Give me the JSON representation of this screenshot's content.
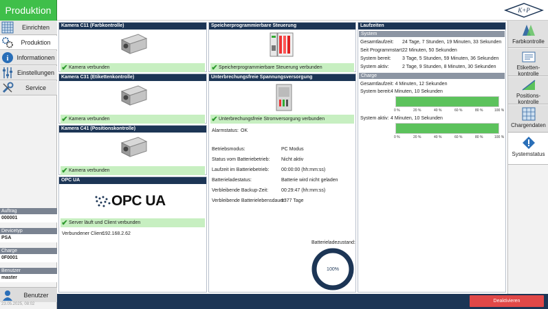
{
  "header": {
    "title": "Produktion"
  },
  "nav": {
    "items": [
      {
        "label": "Einrichten",
        "icon": "grid-tools-icon"
      },
      {
        "label": "Produktion",
        "icon": "gears-icon"
      },
      {
        "label": "Informationen",
        "icon": "info-icon"
      },
      {
        "label": "Einstellungen",
        "icon": "sliders-icon"
      },
      {
        "label": "Service",
        "icon": "wrench-icon"
      }
    ]
  },
  "info": {
    "auftrag_label": "Auftrag",
    "auftrag": "000001",
    "devicetyp_label": "Devicetyp",
    "devicetyp": "PSA",
    "charge_label": "Charge",
    "charge": "0F0001",
    "benutzer_label": "Benutzer",
    "benutzer": "master"
  },
  "user_button": "Benutzer",
  "datetime": "23.05.2025, 08:02",
  "cameras": [
    {
      "title": "Kamera C11 (Farbkontrolle)",
      "status": "Kamera verbunden"
    },
    {
      "title": "Kamera C31 (Etikettenkontrolle)",
      "status": "Kamera verbunden"
    },
    {
      "title": "Kamera C41 (Positionskontrolle)",
      "status": "Kamera verbunden"
    }
  ],
  "opcua": {
    "title": "OPC UA",
    "logo_text": "OPC UA",
    "status": "Server läuft und Client verbunden",
    "client_label": "Verbundener Client:",
    "client_value": "192.168.2.62"
  },
  "sps": {
    "title": "Speicherprogrammierbare Steuerung",
    "status": "Speicherprogrammierbare Steuerung verbunden"
  },
  "usv": {
    "title": "Unterbrechungsfreie Spannungsversorgung",
    "status": "Unterbrechungsfreie Stromversorgung verbunden",
    "alarm_label": "Alarmstatus:",
    "alarm_value": "OK",
    "rows": [
      {
        "label": "Betriebsmodus:",
        "value": "PC Modus"
      },
      {
        "label": "Status vom Batteriebetrieb:",
        "value": "Nicht aktiv"
      },
      {
        "label": "Laufzeit im Batteriebetrieb:",
        "value": "00:00:00 (hh:mm:ss)"
      },
      {
        "label": "Batterieladestatus:",
        "value": "Batterie wird nicht geladen"
      },
      {
        "label": "Verbleibende Backup-Zeit:",
        "value": "00:29:47 (hh:mm:ss)"
      },
      {
        "label": "Verbleibende Batterielebensdauer:",
        "value": "1377 Tage"
      }
    ],
    "battery_label": "Batterieladezustand:",
    "battery_percent": 100,
    "battery_text": "100%"
  },
  "runtime": {
    "title": "Laufzeiten",
    "system_header": "System",
    "system_rows": [
      {
        "label": "Gesamtlaufzeit:",
        "value": "24 Tage, 7 Stunden, 19 Minuten, 33 Sekunden"
      },
      {
        "label": "Seit Programmstart:",
        "value": "22 Minuten, 50 Sekunden"
      },
      {
        "label": "System bereit:",
        "value": "3 Tage, 5 Stunden, 59 Minuten, 36 Sekunden"
      },
      {
        "label": "System aktiv:",
        "value": "2 Tage, 9 Stunden, 8 Minuten, 30 Sekunden"
      }
    ],
    "charge_header": "Charge",
    "charge_total": "Gesamtlaufzeit: 4 Minuten, 12 Sekunden",
    "ready_label": "System bereit:",
    "ready_value": "4 Minuten, 10 Sekunden",
    "active_label": "System aktiv:",
    "active_value": "4 Minuten, 10 Sekunden",
    "ready_fraction": 1.0,
    "active_fraction": 1.0,
    "ticks": [
      "0 %",
      "20 %",
      "40 %",
      "60 %",
      "80 %",
      "100 %"
    ]
  },
  "rightnav": {
    "items": [
      {
        "label": "Farbkontrolle",
        "icon": "color-check-icon"
      },
      {
        "label": "Etiketten-kontrolle",
        "icon": "label-check-icon"
      },
      {
        "label": "Positions-kontrolle",
        "icon": "position-check-icon"
      },
      {
        "label": "Chargendaten",
        "icon": "batch-data-icon"
      },
      {
        "label": "Systemstatus",
        "icon": "warning-icon"
      }
    ]
  },
  "footer": {
    "deactivate": "Deaktivieren"
  },
  "colors": {
    "accent_green": "#3fbf4a",
    "navy": "#1c3555",
    "ok_bg": "#c7efc1",
    "danger": "#e04848"
  }
}
